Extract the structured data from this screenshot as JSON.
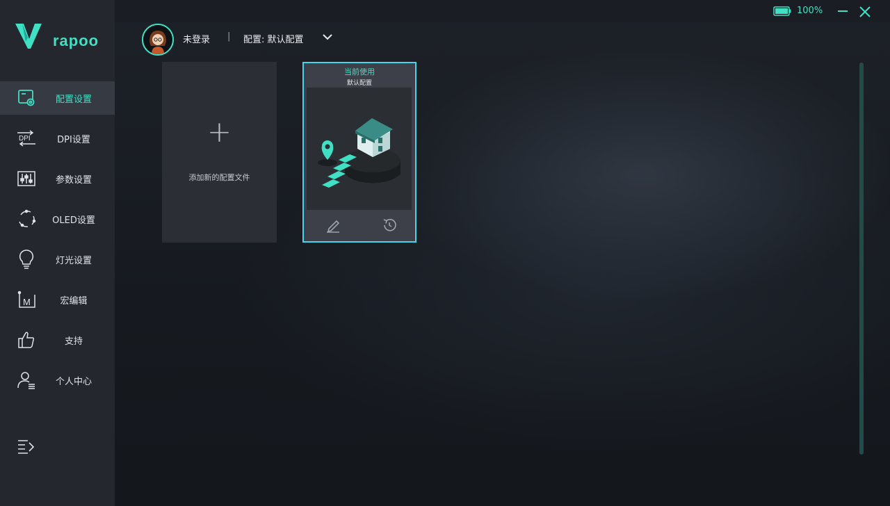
{
  "window": {
    "battery_text": "100%",
    "accent": "#3fe0c4"
  },
  "brand": {
    "name": "rapoo"
  },
  "header": {
    "user_status": "未登录",
    "separator": "|",
    "config_label": "配置: 默认配置"
  },
  "sidebar": {
    "items": [
      {
        "label": "配置设置",
        "icon": "profile-settings-icon",
        "active": true
      },
      {
        "label": "DPI设置",
        "icon": "dpi-icon"
      },
      {
        "label": "参数设置",
        "icon": "sliders-icon"
      },
      {
        "label": "OLED设置",
        "icon": "oled-icon"
      },
      {
        "label": "灯光设置",
        "icon": "lightbulb-icon"
      },
      {
        "label": "宏编辑",
        "icon": "macro-icon"
      },
      {
        "label": "支持",
        "icon": "thumbs-up-icon"
      },
      {
        "label": "个人中心",
        "icon": "user-icon"
      }
    ],
    "collapse_icon": "menu-collapse-icon"
  },
  "cards": {
    "add": {
      "plus": "+",
      "label": "添加新的配置文件"
    },
    "profile": {
      "current_label": "当前使用",
      "name": "默认配置",
      "art_icon": "isometric-house-icon",
      "edit_icon": "pencil-icon",
      "restore_icon": "history-icon"
    }
  }
}
